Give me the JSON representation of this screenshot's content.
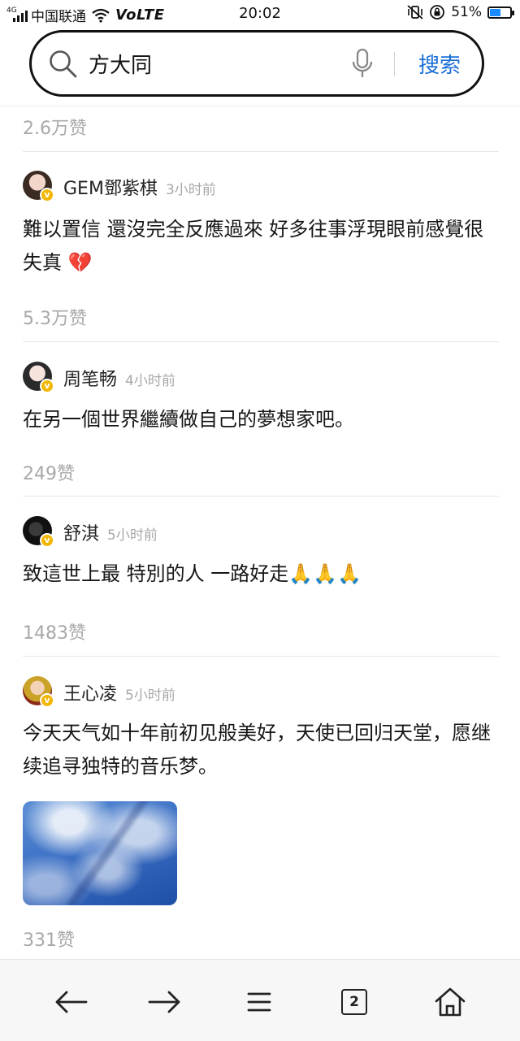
{
  "status_bar": {
    "network": "4G",
    "carrier": "中国联通",
    "volte": "VoLTE",
    "time": "20:02",
    "battery": "51%",
    "battery_level": 0.51,
    "accent": "#1a8cff"
  },
  "search": {
    "query": "方大同",
    "button_label": "搜索",
    "icons": [
      "search-icon",
      "mic-icon"
    ]
  },
  "top_likes": "2.6万赞",
  "comments": [
    {
      "user": "GEM鄧紫棋",
      "time": "3小时前",
      "text": "難以置信 還沒完全反應過來 好多往事浮現眼前感覺很失真",
      "emoji": "💔",
      "likes": "5.3万赞",
      "verified": true
    },
    {
      "user": "周笔畅",
      "time": "4小时前",
      "text": "在另一個世界繼續做自己的夢想家吧。",
      "likes": "249赞",
      "verified": true
    },
    {
      "user": "舒淇",
      "time": "5小时前",
      "text": "致這世上最 特別的人 一路好走",
      "emoji": "🙏🙏🙏",
      "likes": "1483赞",
      "verified": true
    },
    {
      "user": "王心凌",
      "time": "5小时前",
      "text": "今天天气如十年前初见般美好，天使已回归天堂，愿继续追寻独特的音乐梦。",
      "image": "sky-photo",
      "likes": "331赞",
      "verified": true
    }
  ],
  "bottom_nav": {
    "items": [
      "back-icon",
      "forward-icon",
      "menu-icon",
      "tabs-icon",
      "home-icon"
    ],
    "tab_count": "2"
  }
}
